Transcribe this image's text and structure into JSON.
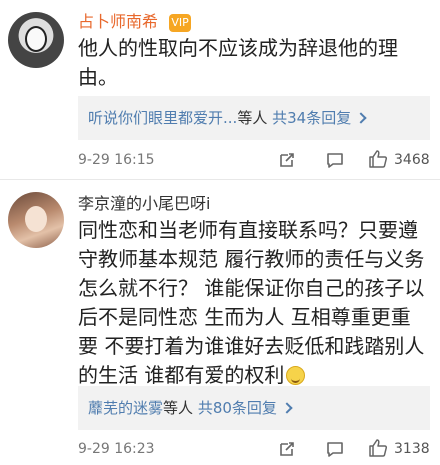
{
  "comments": [
    {
      "username": "占卜师南希",
      "badge": "VIP",
      "text": "他人的性取向不应该成为辞退他的理由。",
      "reply_link": "听说你们眼里都爱开...",
      "reply_mid": "等人",
      "reply_total": "共34条回复",
      "time": "9-29 16:15",
      "likes": "3468",
      "icons": [
        "share-icon",
        "comment-icon",
        "thumbs-up-icon"
      ]
    },
    {
      "username": "李京潼的小尾巴呀i",
      "text": "同性恋和当老师有直接联系吗？只要遵守教师基本规范 履行教师的责任与义务怎么就不行？ 谁能保证你自己的孩子以后不是同性恋 生而为人 互相尊重更重要 不要打着为谁谁好去贬低和践踏别人的生活 谁都有爱的权利",
      "reply_link": "蘼芜的迷雾",
      "reply_mid": "等人",
      "reply_total": "共80条回复",
      "time": "9-29 16:23",
      "likes": "3138",
      "icons": [
        "share-icon",
        "comment-icon",
        "thumbs-up-icon",
        "smile-emoji-icon"
      ]
    }
  ],
  "colors": {
    "vip_name": "#e8682c",
    "link": "#507daf",
    "reply_bg": "#f2f2f2"
  }
}
